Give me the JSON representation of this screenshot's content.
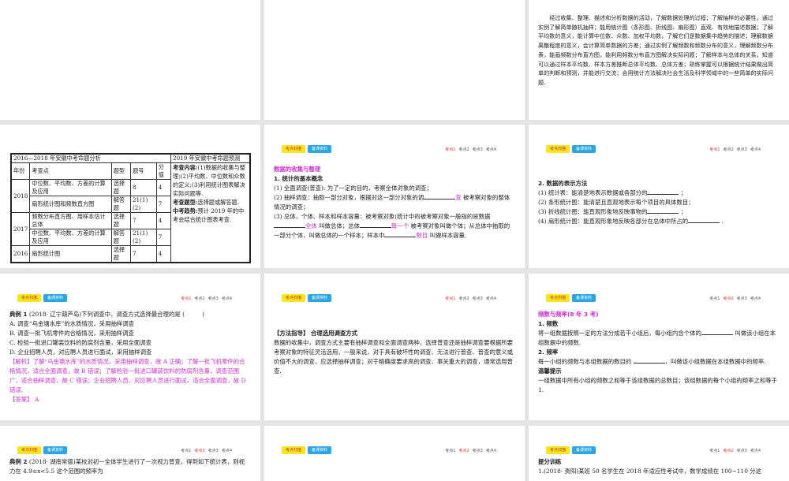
{
  "header": {
    "btn_scan": "考点扫描",
    "btn_prep": "备课资料",
    "points": [
      "考点1",
      "考点2",
      "考点3",
      "考点4"
    ]
  },
  "intro": "经过收集、整理、描述和分析数据的活动，了解数据处理的过程；了解抽样的必要性，通过实例了解简单随机抽样；能用统计图（条形图、折线图、扇形图）直观、有效地描述数据；了解平均数的意义，能计算中位数、众数、加权平均数，了解它们是数据集中趋势的描述；理解数据离散程度的意义，会计算简单数据的方差；通过实例了解频数和频数分布的意义，理解频数分布表，能画频数分布直方图，能利用频数分布直方图解决实际问题；了解样本与总体的关系，知道可以通过样本平均数、样本方差推断总体平均数、总体方差；熟练掌握可以根据统计结果做出简单的判断和预测，并能进行交流；会用统计方法解决社会生活及科学领域中的一些简单的实际问题.",
  "table": {
    "title": "2016—2018 年安徽中考命题分析",
    "pred_title": "2019 年安徽中考命题预测",
    "cols": [
      "年份",
      "考查点",
      "题型",
      "题号",
      "分值"
    ],
    "rows": [
      [
        "2018",
        "中位数、平均数、方差的计算及应用",
        "选择题",
        "8",
        "4"
      ],
      [
        "",
        "扇形统计图和频数直方图",
        "解答题",
        "21(1)(2)",
        "7"
      ],
      [
        "2017",
        "频数分布直方图、用样本估计总体",
        "选择题",
        "7",
        "4"
      ],
      [
        "",
        "中位数、平均数、方差的计算及应用",
        "解答题",
        "21(1)(2)",
        "7"
      ],
      [
        "2016",
        "扇形统计图",
        "选择题",
        "7",
        "4"
      ]
    ],
    "pred": [
      {
        "k": "考查内容:",
        "v": "(1)数据的收集与整理;(2)平均数、中位数和众数的定义;(3)利用统计图表解决实际问题等."
      },
      {
        "k": "考查题型:",
        "v": "选择题或解答题."
      },
      {
        "k": "中考趋势:",
        "v": "预计 2019 年的中考会结合统计图表考查."
      }
    ]
  },
  "s3": {
    "title": "数据的收集与整理",
    "h1": "1. 统计的基本概念",
    "l1": "(1) 全面调查(普查): 为了一定的目的，考察全体对象的调查；",
    "l2a": "(2) 抽样调查：抽取一部分对象，根据对这一部分对象的调",
    "l2b": "查",
    "l2c": "被考察对象的整体情况的调查；",
    "l3a": "(3) 总体、个体、样本和样本容量：被考察对象(统计中的被考察对象一般指的是数据",
    "l3b": "全体",
    "l3c": "叫做总体；总体",
    "l3d": "每一个",
    "l3e": "被考察对象叫做个体；从总体中抽取的一部分个体，叫做总体的一个样本；样本中",
    "l3f": "数目",
    "l3g": "叫做样本容量."
  },
  "s4": {
    "h": "2. 数据的表示方法",
    "l": [
      "(1) 统计表：能清楚地表示数据或各部分的",
      "(2) 条形统计图：能清楚且直观地表示每个项目的具体数目；",
      "(3) 折线统计图：能直观形象地反映事物的",
      "(4) 扇形统计图：能直观形象地反映各部分在总体中所占的"
    ]
  },
  "s5": {
    "q": "典例 1",
    "src": "(2018· 辽宁葫芦岛)下列调查中，调查方式选择最合理的是 (　　　)",
    "opts": [
      "A. 调查“乌金塘水库”的水质情况，采用抽样调查",
      "B. 调查一批飞机零件的合格情况，采用抽样调查",
      "C. 检验一批进口罐装饮料的防腐剂含量，采用全面调查",
      "D. 企业招聘人员，对应聘人员进行面试，采用抽样调查"
    ],
    "jx_label": "【解析】",
    "jx": "了解“乌金塘水库”的水质情况，采用抽样调查，故 A 正确；了解一批飞机零件的合格情况，适合全面调查，故 B 错误；了解检验一批进口罐装饮料的防腐剂含量，调查范围广，适合抽样调查，故 C 错误；企业招聘人员，对应聘人员进行面试，适合全面调查，故 D 错误.",
    "ans_label": "【答案】",
    "ans": "A"
  },
  "s6": {
    "h": "【方法指导】 合理选用调查方式",
    "t": "数据的收集中，调查方式主要有抽样调查和全面调查两种，选择普查还是抽样调查要根据所要考察对象的特征灵活选用，一般来说，对于具有破坏性的调查、无法进行普查、普查的意义或价值不大的调查，应选择抽样调查；对于精确度要求高的调查、事关重大的调查，通常选用普查."
  },
  "s7": {
    "title": "频数与频率(8 年 3 考)",
    "h1": "1. 频数",
    "t1a": "将一组数据按照一定的方法分成若干小组后，每小组内含个体的",
    "t1b": "叫做该小组在本组数据中的频数.",
    "h2": "2. 频率",
    "t2a": "每一小组的频数与本组数据的数目的",
    "t2b": "，叫做该小组数据在本组数据中的频率.",
    "h3": "温馨提示",
    "t3": "一组数据中所有小组的频数之和等于该组数据的总数目；该组数据的每个小组的频率之和等于 1."
  },
  "s8": {
    "q": "典例 2",
    "t": "(2018· 湖南常德)某校对初一全体学生进行了一次视力普查，得到如下统计表，则视力在 4.9≤x<5.5 这个范围的频率为"
  },
  "s9": {
    "h": "提分训练",
    "t": "1.(2018· 贵阳)某班 50 名学生在 2018 年适应性考试中，数学成绩在 100~110 分这"
  }
}
